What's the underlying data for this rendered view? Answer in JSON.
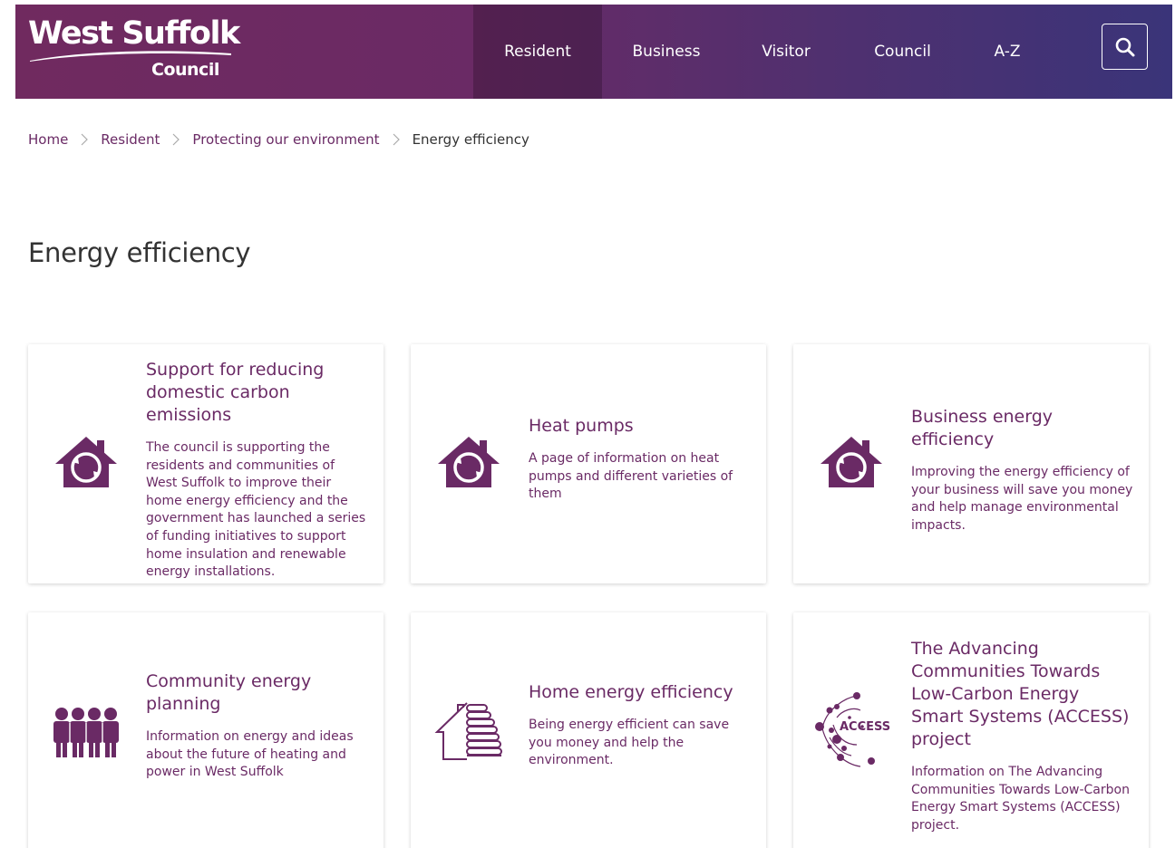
{
  "header": {
    "logo_line1": "West Suffolk",
    "logo_line2": "Council",
    "nav": [
      {
        "label": "Resident",
        "active": true
      },
      {
        "label": "Business"
      },
      {
        "label": "Visitor"
      },
      {
        "label": "Council"
      },
      {
        "label": "A-Z"
      }
    ],
    "search_icon": "search-icon"
  },
  "breadcrumb": [
    "Home",
    "Resident",
    "Protecting our environment",
    "Energy efficiency"
  ],
  "page_title": "Energy efficiency",
  "cards": [
    {
      "title": "Support for reducing domestic carbon emissions",
      "description": "The council is supporting the residents and communities of West Suffolk to improve their home energy efficiency and the government has launched a series of funding initiatives to support home insulation and renewable energy installations.",
      "icon": "house-recycle-icon"
    },
    {
      "title": "Heat pumps",
      "description": "A page of information on heat pumps and different varieties of them",
      "icon": "house-recycle-icon"
    },
    {
      "title": "Business energy efficiency",
      "description": "Improving the energy efficiency of your business will save you money and help manage environmental impacts.",
      "icon": "house-recycle-icon"
    },
    {
      "title": "Community energy planning",
      "description": "Information on energy and ideas about the future of heating and power in West Suffolk",
      "icon": "people-group-icon"
    },
    {
      "title": "Home energy efficiency",
      "description": "Being energy efficient can save you money and help the environment.",
      "icon": "house-radiator-icon"
    },
    {
      "title": "The Advancing Communities Towards Low-Carbon Energy Smart Systems (ACCESS) project",
      "description": "Information on The Advancing Communities Towards Low-Carbon Energy Smart Systems (ACCESS) project.",
      "icon": "access-logo-icon",
      "logo_text": "ACCESS"
    }
  ],
  "colors": {
    "brand": "#6a2a65",
    "header_start": "#702a5f",
    "header_end": "#3a3479"
  }
}
